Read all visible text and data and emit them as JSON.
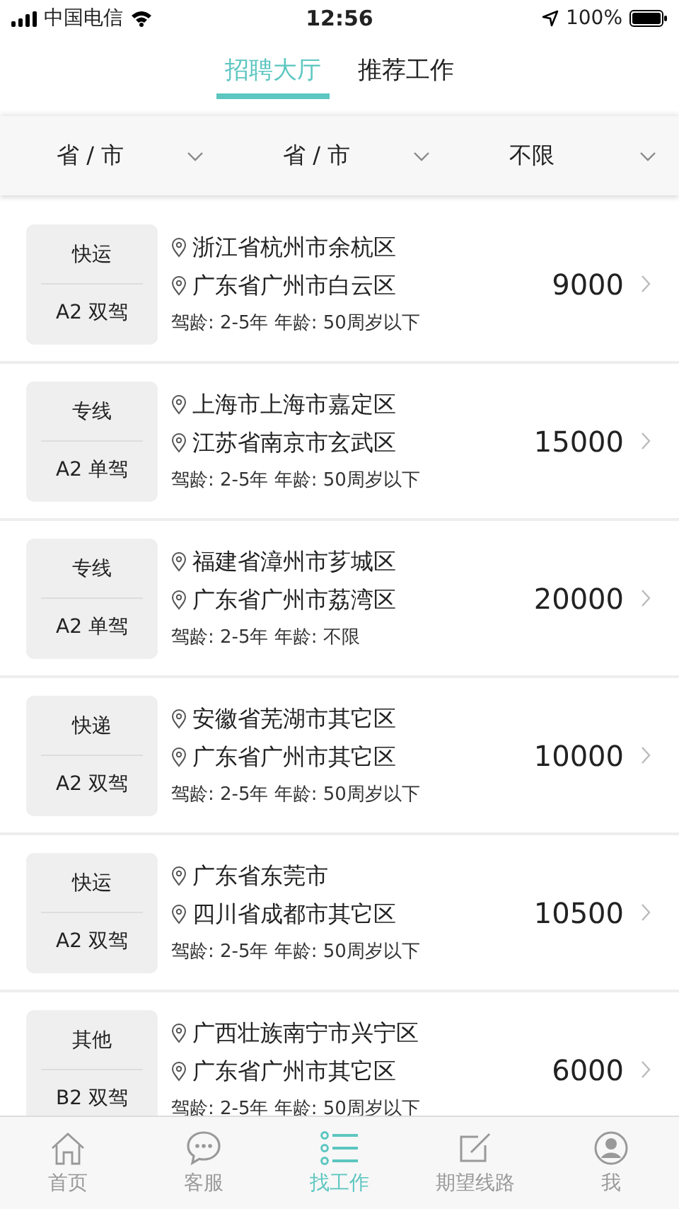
{
  "status_bar": {
    "carrier": "中国电信",
    "time": "12:56",
    "battery": "100%"
  },
  "tabs": [
    {
      "label": "招聘大厅",
      "selected": true
    },
    {
      "label": "推荐工作",
      "selected": false
    }
  ],
  "filters": [
    {
      "label": "省 / 市"
    },
    {
      "label": "省 / 市"
    },
    {
      "label": "不限"
    }
  ],
  "jobs": [
    {
      "category": "快运",
      "license": "A2 双驾",
      "from": "浙江省杭州市余杭区",
      "to": "广东省广州市白云区",
      "requirements": "驾龄: 2-5年 年龄: 50周岁以下",
      "salary": "9000"
    },
    {
      "category": "专线",
      "license": "A2 单驾",
      "from": "上海市上海市嘉定区",
      "to": "江苏省南京市玄武区",
      "requirements": "驾龄: 2-5年 年龄: 50周岁以下",
      "salary": "15000"
    },
    {
      "category": "专线",
      "license": "A2 单驾",
      "from": "福建省漳州市芗城区",
      "to": "广东省广州市荔湾区",
      "requirements": "驾龄: 2-5年 年龄: 不限",
      "salary": "20000"
    },
    {
      "category": "快递",
      "license": "A2 双驾",
      "from": "安徽省芜湖市其它区",
      "to": "广东省广州市其它区",
      "requirements": "驾龄: 2-5年 年龄: 50周岁以下",
      "salary": "10000"
    },
    {
      "category": "快运",
      "license": "A2 双驾",
      "from": "广东省东莞市",
      "to": "四川省成都市其它区",
      "requirements": "驾龄: 2-5年 年龄: 50周岁以下",
      "salary": "10500"
    },
    {
      "category": "其他",
      "license": "B2 双驾",
      "from": "广西壮族南宁市兴宁区",
      "to": "广东省广州市其它区",
      "requirements": "驾龄: 2-5年 年龄: 50周岁以下",
      "salary": "6000"
    }
  ],
  "bottom_nav": [
    {
      "label": "首页",
      "kind": "home",
      "selected": false
    },
    {
      "label": "客服",
      "kind": "chat",
      "selected": false
    },
    {
      "label": "找工作",
      "kind": "list",
      "selected": true
    },
    {
      "label": "期望线路",
      "kind": "edit",
      "selected": false
    },
    {
      "label": "我",
      "kind": "person",
      "selected": false
    }
  ]
}
